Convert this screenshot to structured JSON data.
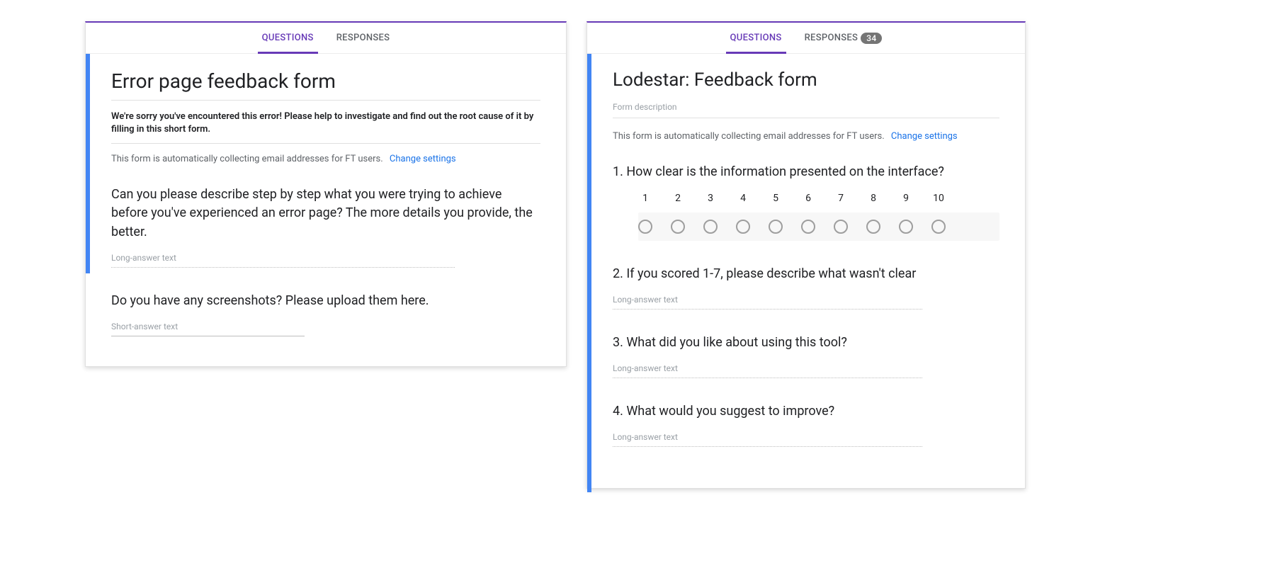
{
  "tabs": {
    "questions": "QUESTIONS",
    "responses": "RESPONSES",
    "response_count": "34"
  },
  "collect": {
    "text": "This form is automatically collecting email addresses for FT users.",
    "link": "Change settings"
  },
  "answerHints": {
    "long": "Long-answer text",
    "short": "Short-answer text"
  },
  "leftForm": {
    "title": "Error page feedback form",
    "description": "We're sorry you've encountered this error! Please help to investigate and find out the root cause of it by filling in this short form.",
    "q1": "Can you please describe step by step what you were trying to achieve before you've experienced an error page? The more details you provide, the better.",
    "q2": "Do you have any screenshots? Please upload them here."
  },
  "rightForm": {
    "title": "Lodestar: Feedback form",
    "desc_placeholder": "Form description",
    "q1": "1. How clear is the information presented on the interface?",
    "scale": [
      "1",
      "2",
      "3",
      "4",
      "5",
      "6",
      "7",
      "8",
      "9",
      "10"
    ],
    "q2": "2. If you scored 1-7, please describe what wasn't clear",
    "q3": "3. What did you like about using this tool?",
    "q4": "4. What would you suggest to improve?"
  }
}
